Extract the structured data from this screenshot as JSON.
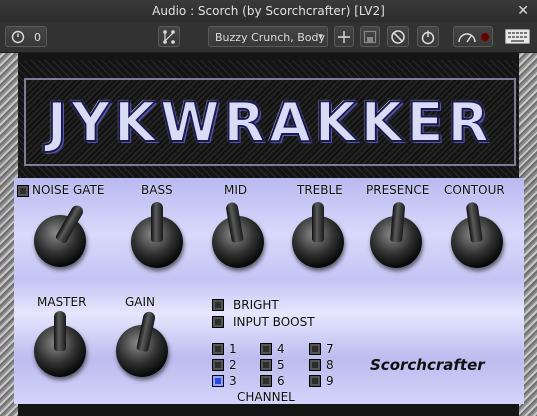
{
  "window": {
    "title": "Audio : Scorch (by Scorchcrafter) [LV2]",
    "close_glyph": "✕"
  },
  "toolbar": {
    "latency_value": "0",
    "preset": "Buzzy Crunch, Body",
    "preset_arrow": "▾"
  },
  "plugin": {
    "logo": "JYKWRAKKER",
    "brand": "Scorchcrafter",
    "knobs": {
      "noise_gate": "NOISE GATE",
      "bass": "BASS",
      "mid": "MID",
      "treble": "TREBLE",
      "presence": "PRESENCE",
      "contour": "CONTOUR",
      "master": "MASTER",
      "gain": "GAIN"
    },
    "switches": {
      "bright": "BRIGHT",
      "input_boost": "INPUT BOOST"
    },
    "channel": {
      "label": "CHANNEL",
      "numbers": [
        "1",
        "2",
        "3",
        "4",
        "5",
        "6",
        "7",
        "8",
        "9"
      ],
      "selected": "3"
    },
    "colors": {
      "face": "#c8c8f4",
      "active_led": "#2b46e0"
    }
  }
}
